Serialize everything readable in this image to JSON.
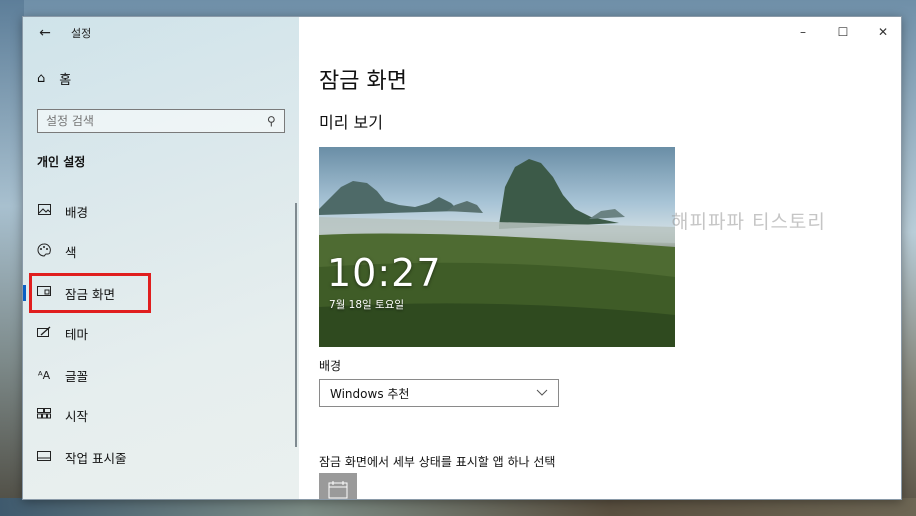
{
  "window": {
    "app_title": "설정",
    "controls": {
      "minimize": "–",
      "maximize": "☐",
      "close": "✕"
    }
  },
  "sidebar": {
    "home_label": "홈",
    "search_placeholder": "설정 검색",
    "section_title": "개인 설정",
    "items": [
      {
        "label": "배경",
        "icon": "picture-icon"
      },
      {
        "label": "색",
        "icon": "palette-icon"
      },
      {
        "label": "잠금 화면",
        "icon": "lock-screen-icon",
        "active": true
      },
      {
        "label": "테마",
        "icon": "theme-brush-icon"
      },
      {
        "label": "글꼴",
        "icon": "font-icon"
      },
      {
        "label": "시작",
        "icon": "start-grid-icon"
      },
      {
        "label": "작업 표시줄",
        "icon": "taskbar-icon"
      }
    ]
  },
  "main": {
    "page_title": "잠금 화면",
    "preview_title": "미리 보기",
    "preview": {
      "time": "10:27",
      "date": "7월 18일 토요일"
    },
    "watermark": "해피파파 티스토리",
    "background_label": "배경",
    "background_value": "Windows 추천",
    "app_choose_label": "잠금 화면에서 세부 상태를 표시할 앱 하나 선택"
  },
  "colors": {
    "accent": "#0a5fc4",
    "highlight_box": "#e01e1e",
    "sidebar_bg": "#dde9ec"
  }
}
